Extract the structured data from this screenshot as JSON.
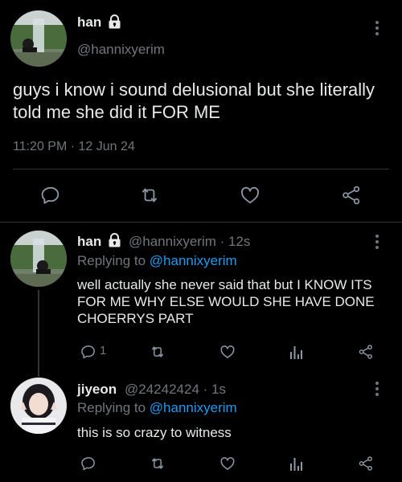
{
  "main_tweet": {
    "display_name": "han",
    "handle": "@hannixyerim",
    "text": "guys i know i sound delusional but she literally told me she did it FOR ME",
    "timestamp": "11:20 PM · 12 Jun 24",
    "avatar_icon": "waterfall-avatar",
    "lock_icon": "lock-icon"
  },
  "replies": [
    {
      "display_name": "han",
      "handle_time": "@hannixyerim · 12s",
      "replying_prefix": "Replying to ",
      "replying_to": "@hannixyerim",
      "text": "well actually she never said that but I KNOW ITS FOR ME WHY ELSE WOULD SHE HAVE DONE CHOERRYS PART",
      "reply_count": "1"
    },
    {
      "display_name": "jiyeon",
      "handle_time": "@24242424 · 1s",
      "replying_prefix": "Replying to ",
      "replying_to": "@hannixyerim",
      "text": "this is so crazy to witness",
      "reply_count": ""
    }
  ],
  "colors": {
    "background": "#000000",
    "text": "#e7e9ea",
    "muted": "#71767b",
    "link": "#1d9bf0",
    "divider": "#2f3336"
  }
}
